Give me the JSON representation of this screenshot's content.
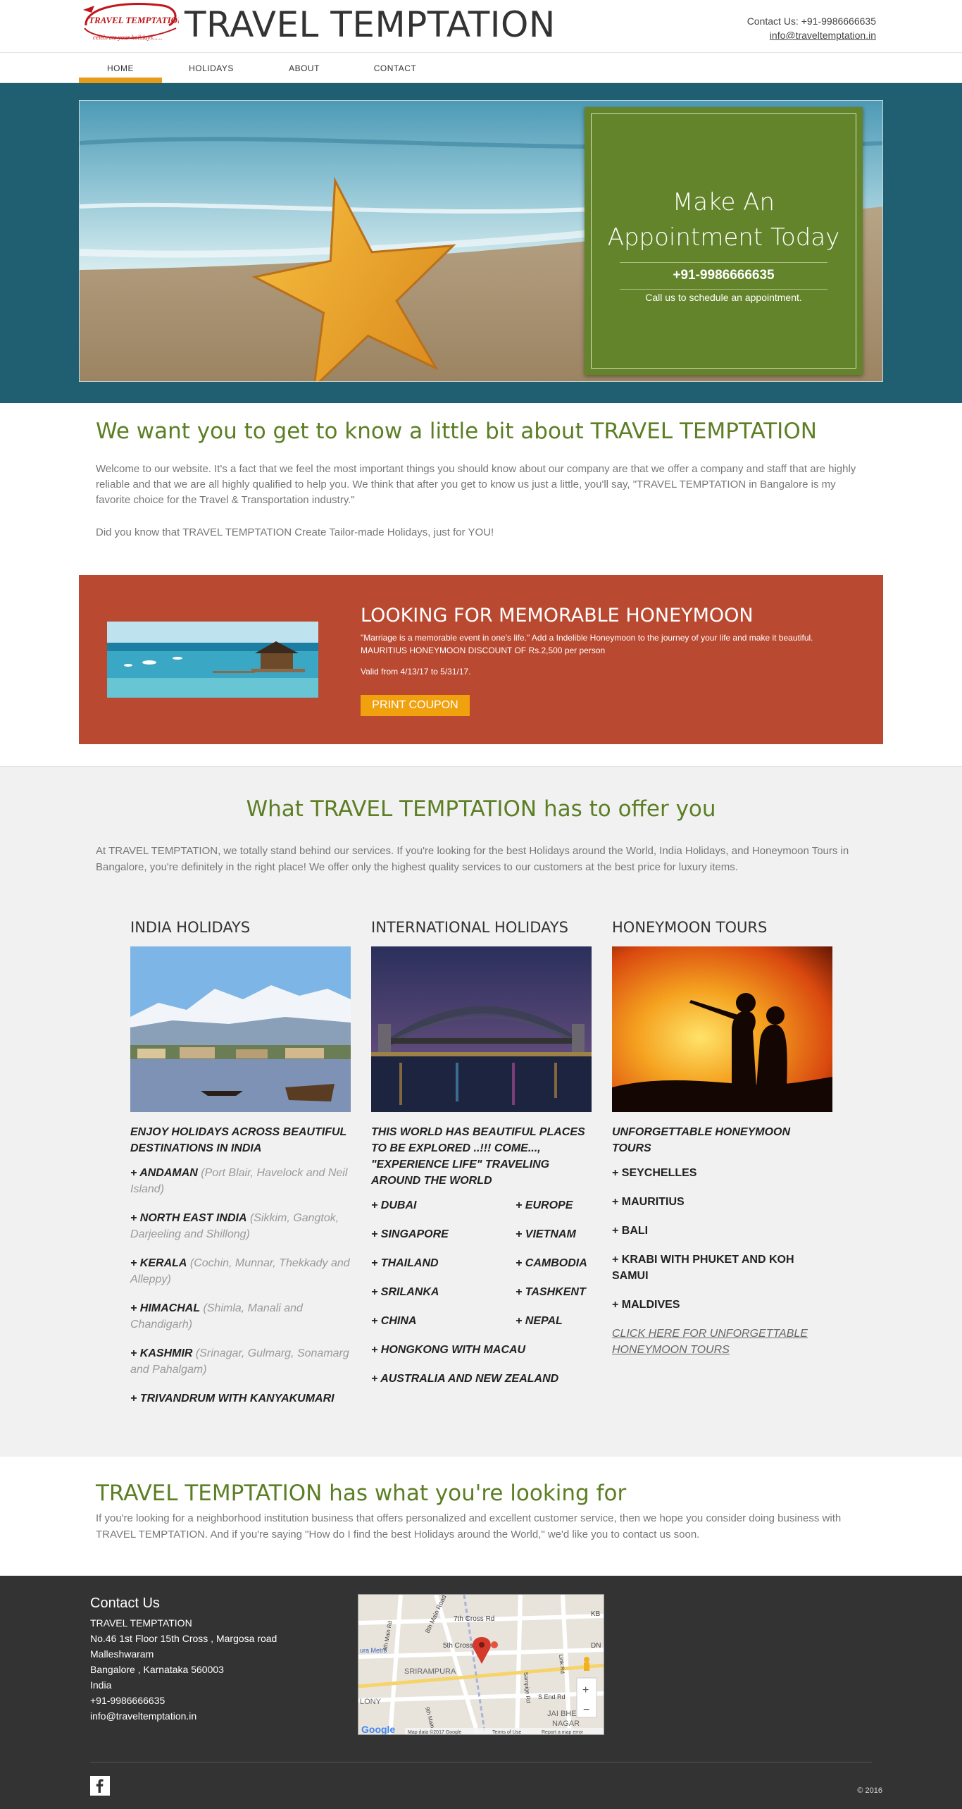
{
  "brand": {
    "title": "TRAVEL TEMPTATION",
    "logo_text": "TRAVEL TEMPTATION",
    "logo_tagline": "celebrate your holidays......"
  },
  "header": {
    "contact_label": "Contact Us:",
    "phone": "+91-9986666635",
    "email": "info@traveltemptation.in"
  },
  "nav": [
    "HOME",
    "HOLIDAYS",
    "ABOUT",
    "CONTACT"
  ],
  "hero": {
    "title": "Make An Appointment Today",
    "phone": "+91-9986666635",
    "subtitle": "Call us to schedule an appointment."
  },
  "about": {
    "title": "We want you to get to know a little bit about TRAVEL TEMPTATION",
    "text": "Welcome to our website. It's a fact that we feel the most important things you should know about our company are that we offer a company and staff that are highly reliable and that we are all highly qualified to help you. We think that after you get to know us just a little, you'll say, \"TRAVEL TEMPTATION in Bangalore is my favorite choice for the Travel & Transportation industry.\"",
    "text2": "Did you know that TRAVEL TEMPTATION Create Tailor-made Holidays, just for YOU!"
  },
  "coupon": {
    "title": "LOOKING FOR MEMORABLE HONEYMOON",
    "desc": "\"Marriage is a memorable event in one's life.\" Add a Indelible Honeymoon to the journey of your life and make it beautiful. MAURITIUS HONEYMOON DISCOUNT OF Rs.2,500 per person",
    "valid": "Valid from 4/13/17 to 5/31/17.",
    "button": "PRINT COUPON"
  },
  "offer": {
    "title": "What TRAVEL TEMPTATION has to offer you",
    "text": "At TRAVEL TEMPTATION, we totally stand behind our services. If you're looking for the best Holidays around the World, India Holidays, and Honeymoon Tours in Bangalore, you're definitely in the right place! We offer only the highest quality services to our customers at the best price for luxury items."
  },
  "col1": {
    "head": "INDIA HOLIDAYS",
    "lead": "ENJOY HOLIDAYS ACROSS BEAUTIFUL DESTINATIONS IN INDIA",
    "items": [
      {
        "name": "+ ANDAMAN",
        "sub": " (Port Blair, Havelock and Neil Island)"
      },
      {
        "name": "+ NORTH EAST INDIA",
        "sub": " (Sikkim, Gangtok, Darjeeling and Shillong)"
      },
      {
        "name": "+ KERALA",
        "sub": " (Cochin, Munnar, Thekkady and Alleppy)"
      },
      {
        "name": "+ HIMACHAL",
        "sub": " (Shimla, Manali and Chandigarh)"
      },
      {
        "name": "+ KASHMIR",
        "sub": " (Srinagar, Gulmarg, Sonamarg and Pahalgam)"
      },
      {
        "name": "+ TRIVANDRUM WITH KANYAKUMARI",
        "sub": ""
      }
    ]
  },
  "col2": {
    "head": "INTERNATIONAL HOLIDAYS",
    "lead": "THIS WORLD HAS BEAUTIFUL PLACES TO BE EXPLORED ..!!!      COME..., \"EXPERIENCE LIFE\" TRAVELING AROUND THE WORLD",
    "pairs": [
      [
        "+ DUBAI",
        "+ EUROPE"
      ],
      [
        "+ SINGAPORE",
        "+ VIETNAM"
      ],
      [
        "+ THAILAND",
        "+ CAMBODIA"
      ],
      [
        "+ SRILANKA",
        "+ TASHKENT"
      ],
      [
        "+ CHINA",
        "+ NEPAL"
      ]
    ],
    "wide": [
      "+ HONGKONG WITH MACAU",
      "+ AUSTRALIA AND NEW ZEALAND"
    ]
  },
  "col3": {
    "head": "HONEYMOON TOURS",
    "lead": "UNFORGETTABLE HONEYMOON TOURS",
    "items": [
      "+ SEYCHELLES",
      "+ MAURITIUS",
      "+ BALI",
      "+ KRABI WITH PHUKET AND KOH SAMUI",
      "+ MALDIVES"
    ],
    "link": "CLICK HERE FOR UNFORGETTABLE HONEYMOON TOURS"
  },
  "looking": {
    "title": "TRAVEL TEMPTATION has what you're looking for",
    "text": "If you're looking for a neighborhood institution business that offers personalized and excellent customer service, then we hope you consider doing business with TRAVEL TEMPTATION. And if you're saying \"How do I find the best Holidays around the World,\" we'd like you to contact us soon."
  },
  "footer": {
    "title": "Contact Us",
    "lines": [
      "TRAVEL TEMPTATION",
      "No.46 1st Floor 15th Cross , Margosa road",
      "Malleshwaram",
      "Bangalore , Karnataka  560003",
      "India",
      "+91-9986666635",
      "info@traveltemptation.in"
    ],
    "copyright": "© 2016"
  },
  "map": {
    "labels": [
      "7th Cross Rd",
      "4th Main Rd",
      "8th Main Road",
      "5th Cross",
      "Sampige Rd",
      "Link Rd",
      "SRIRAMPURA",
      "S End Rd",
      "LONY",
      "JAI BHEEM",
      "NAGAR",
      "9th Main",
      "KB",
      "DN",
      "ura Metro"
    ],
    "credit": "Map data ©2017 Google",
    "terms": "Terms of Use",
    "report": "Report a map error",
    "google": "Google",
    "zoom_in": "+",
    "zoom_out": "−"
  },
  "colors": {
    "accent": "#e79b16",
    "hero_band": "#205e72",
    "appt_box": "#63842a",
    "coupon": "#b94930",
    "green_title": "#5c7e24",
    "footer": "#333333"
  }
}
